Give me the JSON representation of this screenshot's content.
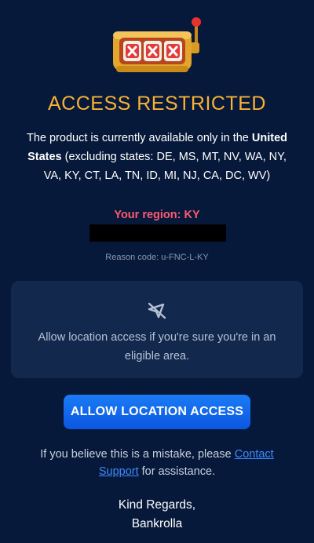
{
  "header": {
    "icon": "slot-machine-icon",
    "title": "ACCESS RESTRICTED"
  },
  "description": {
    "prefix": "The product is currently available only in the",
    "country": "United States",
    "exclusions": "(excluding states: DE, MS, MT, NV, WA, NY, VA, KY, CT, LA, TN, ID, MI, NJ, CA, DC, WV)"
  },
  "region": {
    "text": "Your region: KY"
  },
  "reason": {
    "text": "Reason code: u-FNC-L-KY"
  },
  "location_card": {
    "icon": "location-off-icon",
    "text": "Allow location access if you're sure you're in an eligible area."
  },
  "actions": {
    "allow_label": "ALLOW LOCATION ACCESS"
  },
  "help": {
    "prefix": "If you believe this is a mistake, please",
    "link_label": "Contact Support",
    "suffix": "for assistance."
  },
  "footer": {
    "line1": "Kind Regards,",
    "line2": "Bankrolla"
  },
  "colors": {
    "background": "#07193a",
    "title": "#f9b233",
    "region": "#ff5a6e",
    "button": "#0f66f0",
    "link": "#3d8bff"
  }
}
